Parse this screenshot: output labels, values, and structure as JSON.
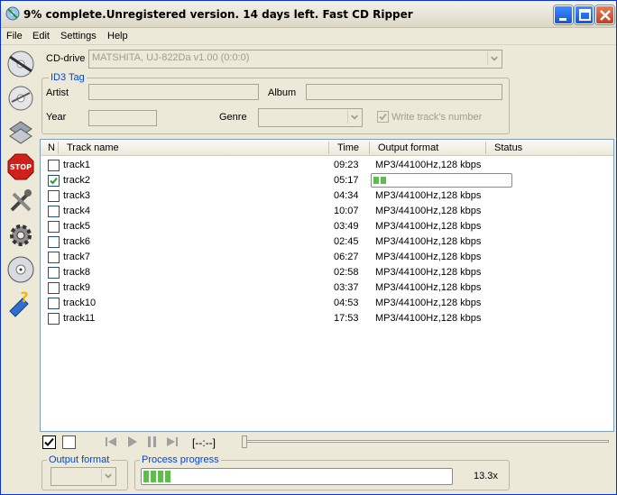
{
  "window": {
    "title": "9% complete.Unregistered version. 14 days left. Fast CD Ripper"
  },
  "menu": [
    {
      "label": "File"
    },
    {
      "label": "Edit"
    },
    {
      "label": "Settings"
    },
    {
      "label": "Help"
    }
  ],
  "toolbar": {
    "icons": [
      "rip-cd-icon",
      "eject-icon",
      "network-icon",
      "stop-icon",
      "tools-icon",
      "settings-gear-icon",
      "cd-info-icon",
      "help-icon"
    ]
  },
  "cd": {
    "label": "CD-drive",
    "drive_value": "MATSHITA, UJ-822Da         v1.00 (0:0:0)"
  },
  "id3": {
    "group_label": "ID3 Tag",
    "artist_label": "Artist",
    "artist_value": "",
    "album_label": "Album",
    "album_value": "",
    "year_label": "Year",
    "year_value": "",
    "genre_label": "Genre",
    "genre_value": "",
    "write_track_label": "Write track's number",
    "write_track_checked": true
  },
  "list": {
    "columns": [
      "N",
      "Track name",
      "Time",
      "Output format",
      "Status"
    ],
    "rows": [
      {
        "checked": false,
        "name": "track1",
        "time": "09:23",
        "format": "MP3/44100Hz,128 kbps",
        "status": ""
      },
      {
        "checked": true,
        "name": "track2",
        "time": "05:17",
        "format": "",
        "status": "",
        "progress": 0.09
      },
      {
        "checked": false,
        "name": "track3",
        "time": "04:34",
        "format": "MP3/44100Hz,128 kbps",
        "status": ""
      },
      {
        "checked": false,
        "name": "track4",
        "time": "10:07",
        "format": "MP3/44100Hz,128 kbps",
        "status": ""
      },
      {
        "checked": false,
        "name": "track5",
        "time": "03:49",
        "format": "MP3/44100Hz,128 kbps",
        "status": ""
      },
      {
        "checked": false,
        "name": "track6",
        "time": "02:45",
        "format": "MP3/44100Hz,128 kbps",
        "status": ""
      },
      {
        "checked": false,
        "name": "track7",
        "time": "06:27",
        "format": "MP3/44100Hz,128 kbps",
        "status": ""
      },
      {
        "checked": false,
        "name": "track8",
        "time": "02:58",
        "format": "MP3/44100Hz,128 kbps",
        "status": ""
      },
      {
        "checked": false,
        "name": "track9",
        "time": "03:37",
        "format": "MP3/44100Hz,128 kbps",
        "status": ""
      },
      {
        "checked": false,
        "name": "track10",
        "time": "04:53",
        "format": "MP3/44100Hz,128 kbps",
        "status": ""
      },
      {
        "checked": false,
        "name": "track11",
        "time": "17:53",
        "format": "MP3/44100Hz,128 kbps",
        "status": ""
      }
    ]
  },
  "player": {
    "time_display": "[--:--]",
    "position": 0
  },
  "output_format": {
    "group_label": "Output format",
    "value": ""
  },
  "process": {
    "group_label": "Process progress",
    "progress": 0.09,
    "speed": "13.3x"
  },
  "colors": {
    "progress_green": "#5cbf4a",
    "group_label_blue": "#0046d5",
    "window_bg": "#ece9d8"
  }
}
